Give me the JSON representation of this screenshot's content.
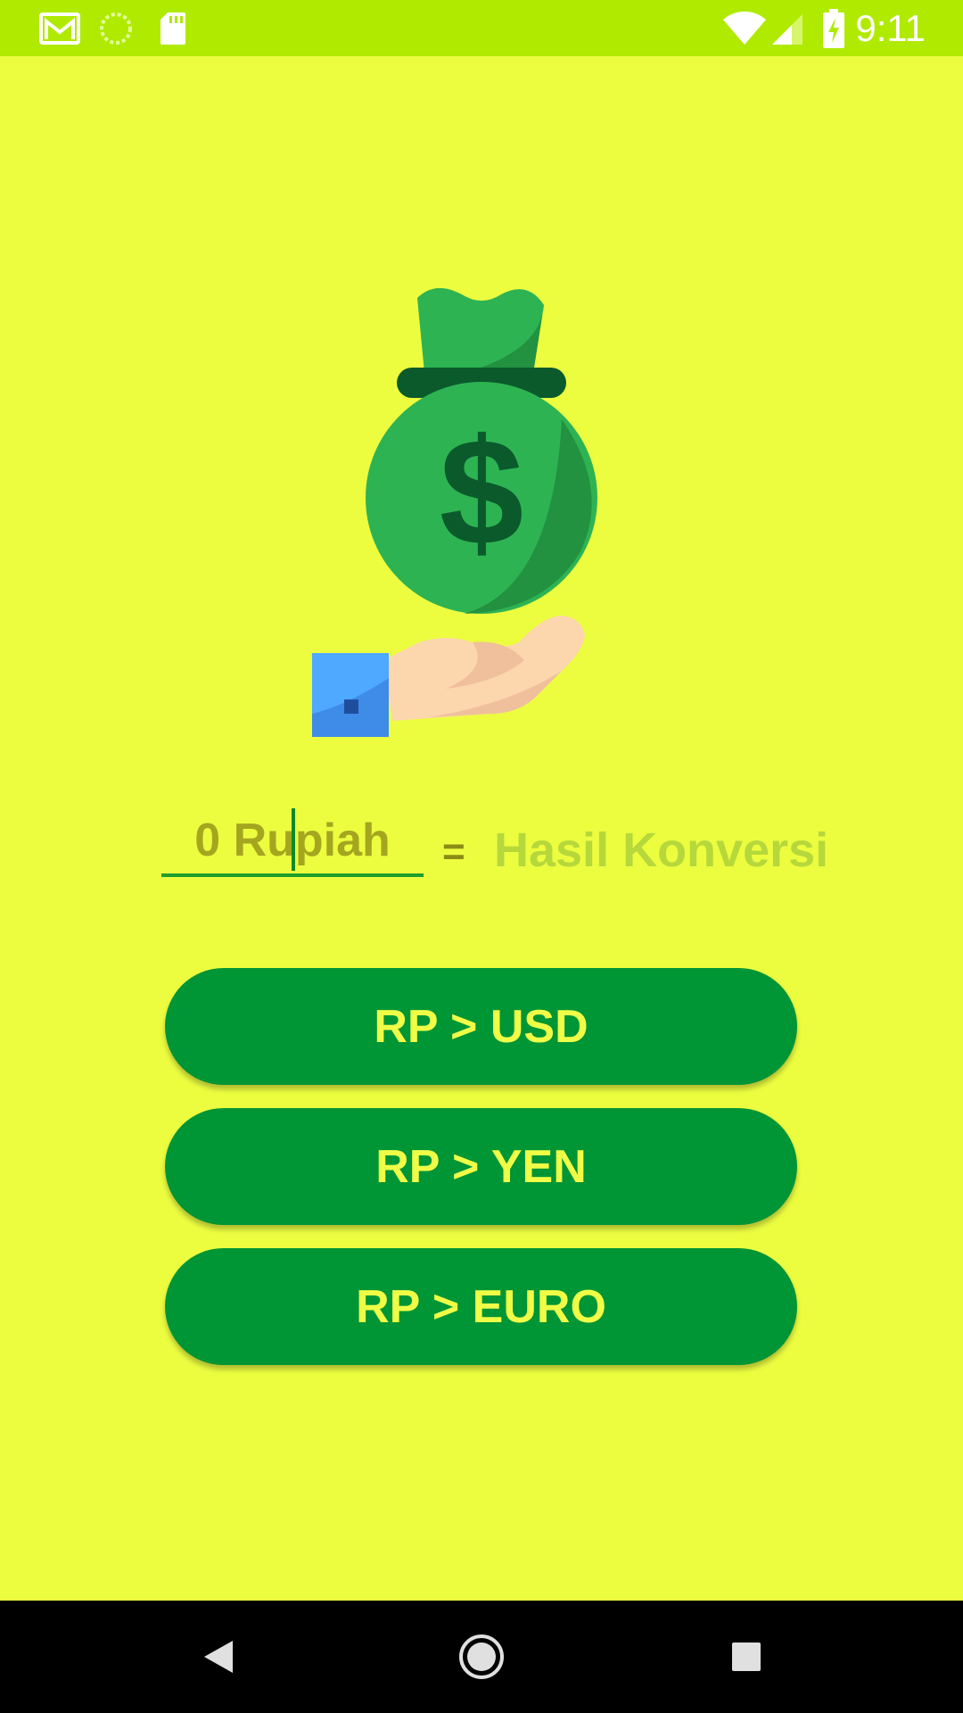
{
  "status_bar": {
    "time": "9:11",
    "left_icons": [
      "gmail-icon",
      "sync-icon",
      "sd-card-icon"
    ],
    "right_icons": [
      "wifi-icon",
      "cellular-signal-icon",
      "battery-charging-icon"
    ]
  },
  "illustration": {
    "icon": "money-bag-hand-icon",
    "symbol": "$"
  },
  "converter": {
    "input_placeholder": "0 Rupiah",
    "input_value": "",
    "equals_sign": "=",
    "result_text": "Hasil Konversi"
  },
  "buttons": {
    "usd_label": "RP > USD",
    "yen_label": "RP > YEN",
    "euro_label": "RP > EURO"
  },
  "nav_bar": {
    "icons": [
      "back-icon",
      "home-icon",
      "recents-icon"
    ]
  },
  "colors": {
    "background": "#ecfd40",
    "status_bar": "#b0ea00",
    "button": "#009535",
    "button_text": "#f0fd47",
    "bag_green": "#2eb352"
  }
}
